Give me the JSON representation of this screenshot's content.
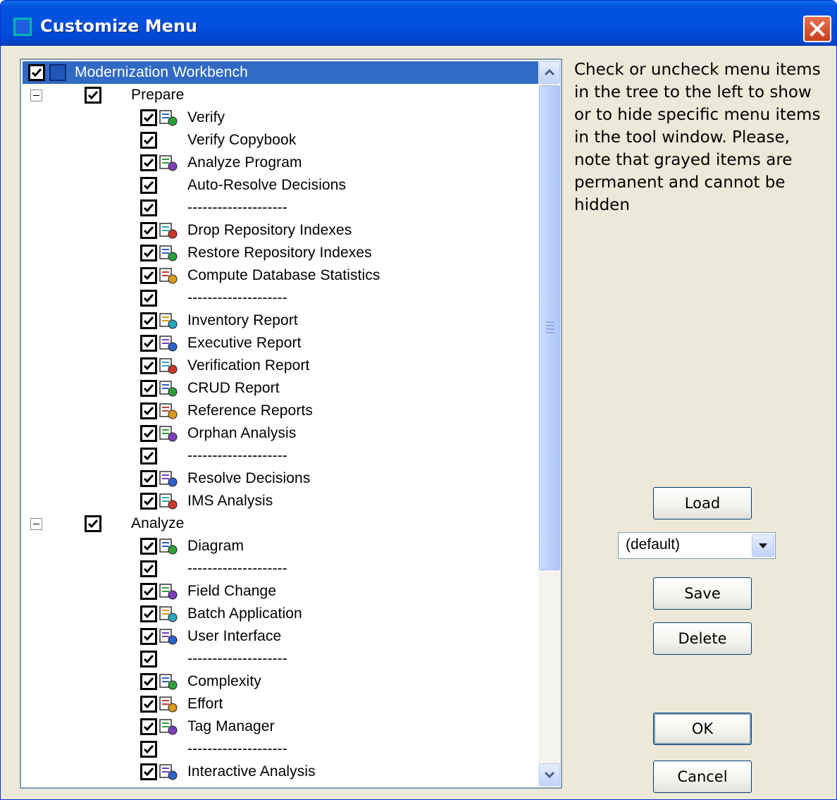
{
  "window": {
    "title": "Customize Menu"
  },
  "tree": {
    "root": "Modernization Workbench",
    "prepare": {
      "label": "Prepare",
      "items": [
        "Verify",
        "Verify Copybook",
        "Analyze Program",
        "Auto-Resolve Decisions",
        "--------------------",
        "Drop Repository Indexes",
        "Restore Repository Indexes",
        "Compute Database Statistics",
        "--------------------",
        "Inventory Report",
        "Executive Report",
        "Verification Report",
        "CRUD Report",
        "Reference Reports",
        "Orphan Analysis",
        "--------------------",
        "Resolve Decisions",
        "IMS Analysis"
      ]
    },
    "analyze": {
      "label": "Analyze",
      "items": [
        "Diagram",
        "--------------------",
        "Field Change",
        "Batch Application",
        "User Interface",
        "--------------------",
        "Complexity",
        "Effort",
        "Tag Manager",
        "--------------------",
        "Interactive Analysis"
      ]
    }
  },
  "help": {
    "text": "Check or uncheck menu items in the tree to the left to show or to hide specific menu items in the tool window. Please, note that grayed items are permanent and cannot be hidden"
  },
  "buttons": {
    "load": "Load",
    "save": "Save",
    "delete": "Delete",
    "ok": "OK",
    "cancel": "Cancel"
  },
  "profile_select": {
    "value": "(default)"
  }
}
